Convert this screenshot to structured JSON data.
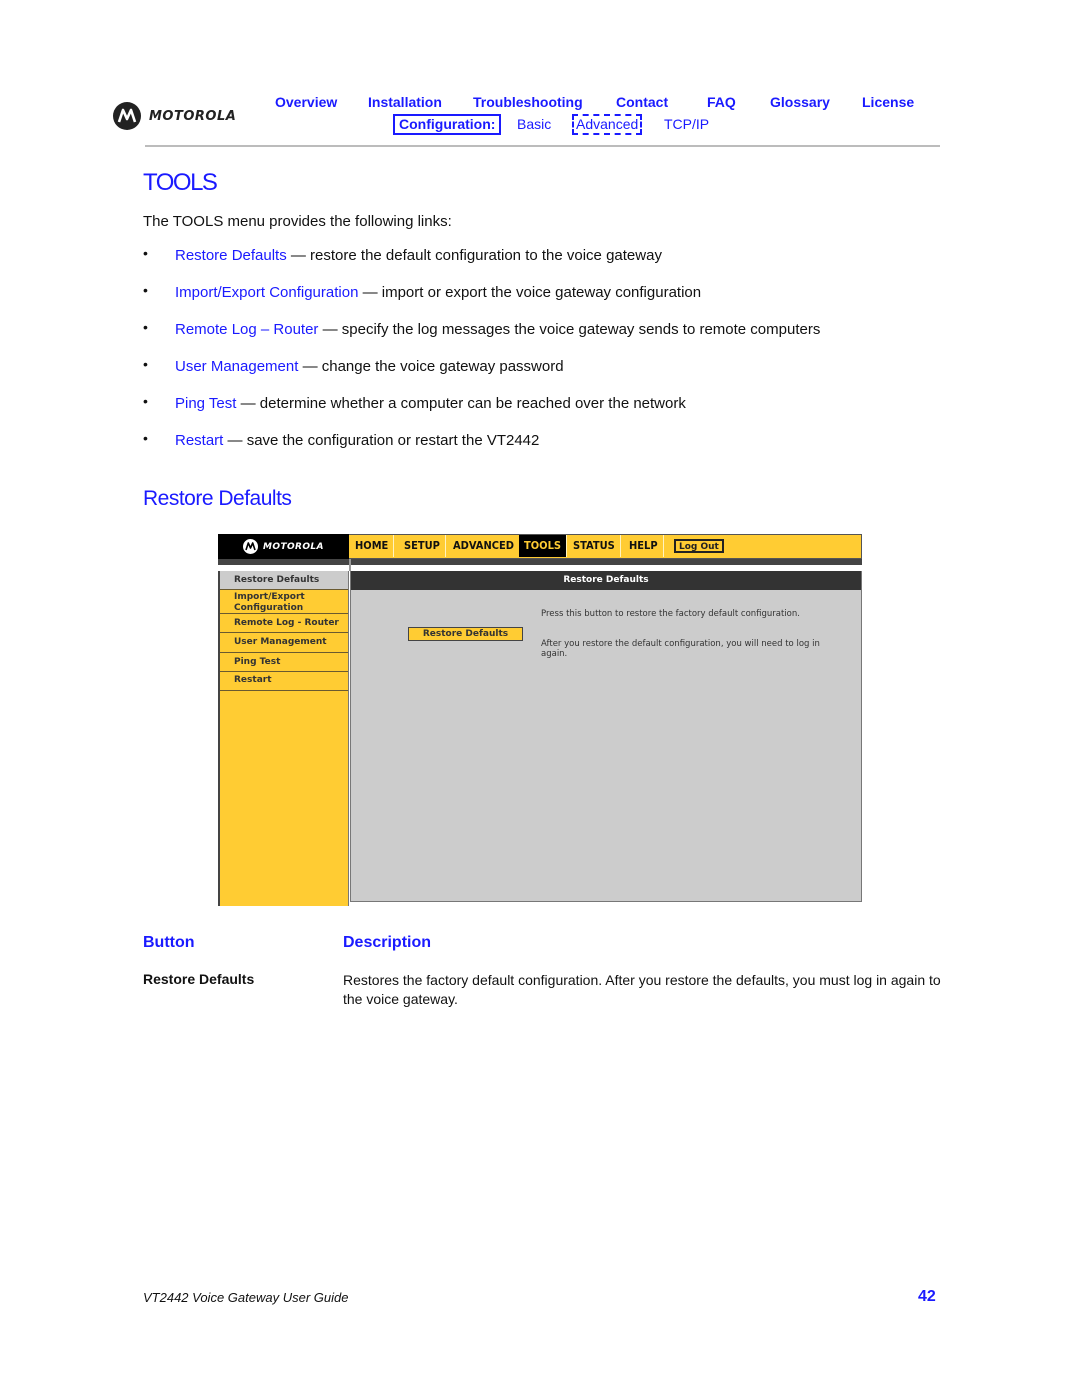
{
  "header": {
    "brand": "MOTOROLA",
    "nav": [
      {
        "label": "Overview"
      },
      {
        "label": "Installation"
      },
      {
        "label": "Troubleshooting"
      },
      {
        "label": "Contact"
      },
      {
        "label": "FAQ"
      },
      {
        "label": "Glossary"
      },
      {
        "label": "License"
      }
    ],
    "config_label": "Configuration:",
    "config_links": [
      {
        "label": "Basic"
      },
      {
        "label": "Advanced"
      },
      {
        "label": "TCP/IP"
      }
    ]
  },
  "section": {
    "title": "TOOLS",
    "intro": "The TOOLS menu provides the following links:",
    "bullet_glyph": "•",
    "items": [
      {
        "link": "Restore Defaults",
        "text": " — restore the default configuration to the voice gateway"
      },
      {
        "link": "Import/Export Configuration",
        "text": " — import or export the voice gateway configuration"
      },
      {
        "link": "Remote Log – Router",
        "text": " — specify the log messages the voice gateway sends to remote computers"
      },
      {
        "link": "User Management",
        "text": " — change the voice gateway password"
      },
      {
        "link": "Ping Test",
        "text": " — determine whether a computer can be reached over the network"
      },
      {
        "link": "Restart",
        "text": " — save the configuration or restart the VT2442"
      }
    ]
  },
  "subsection": {
    "title": "Restore Defaults"
  },
  "screenshot": {
    "brand": "MOTOROLA",
    "tabs": [
      {
        "label": "HOME",
        "active": false
      },
      {
        "label": "SETUP",
        "active": false
      },
      {
        "label": "ADVANCED",
        "active": false
      },
      {
        "label": "TOOLS",
        "active": true
      },
      {
        "label": "STATUS",
        "active": false
      },
      {
        "label": "HELP",
        "active": false
      }
    ],
    "logout_label": "Log Out",
    "sidebar": [
      {
        "label": "Restore Defaults",
        "selected": true
      },
      {
        "label": "Import/Export Configuration",
        "selected": false
      },
      {
        "label": "Remote Log - Router",
        "selected": false
      },
      {
        "label": "User Management",
        "selected": false
      },
      {
        "label": "Ping Test",
        "selected": false
      },
      {
        "label": "Restart",
        "selected": false
      }
    ],
    "panel_title": "Restore Defaults",
    "button_label": "Restore Defaults",
    "help_text_1": "Press this button to restore the factory default configuration.",
    "help_text_2": "After you restore the default configuration, you will need to log in again.",
    "colors": {
      "accent": "#ffcc33",
      "panel": "#cccccc",
      "bar": "#333333"
    }
  },
  "table": {
    "headers": [
      "Button",
      "Description"
    ],
    "rows": [
      {
        "button": "Restore Defaults",
        "description": "Restores the factory default configuration. After you restore the defaults, you must log in again to the voice gateway."
      }
    ]
  },
  "footer": {
    "title": "VT2442 Voice Gateway User Guide",
    "page": "42"
  },
  "colors": {
    "link": "#1a1aff",
    "text": "#111111",
    "rule": "#bcbcbc"
  }
}
